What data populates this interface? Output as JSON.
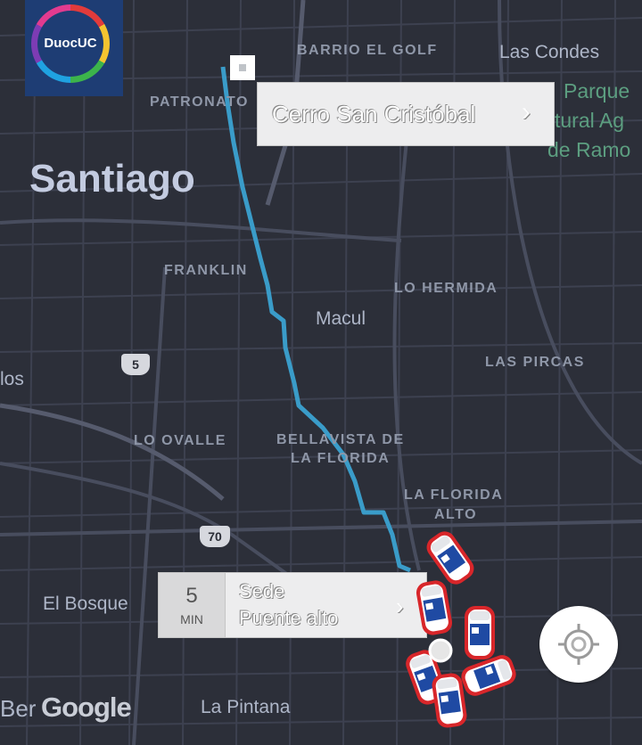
{
  "map": {
    "city": "Santiago",
    "attribution": "Google",
    "labels": {
      "barrio_el_golf": "BARRIO EL GOLF",
      "las_condes": "Las Condes",
      "patronato": "PATRONATO",
      "parque": "Parque",
      "parque_line2": "tural Ag",
      "parque_line3": "de Ramo",
      "franklin": "FRANKLIN",
      "lo_hermida": "LO HERMIDA",
      "macul": "Macul",
      "las_pircas": "LAS PIRCAS",
      "los": "los",
      "lo_ovalle": "LO OVALLE",
      "bellavista": "BELLAVISTA DE",
      "la_florida_line": "LA FLORIDA",
      "la_florida_alto1": "LA FLORIDA",
      "la_florida_alto2": "ALTO",
      "el_bosque": "El Bosque",
      "la_pintana": "La Pintana",
      "ber": "Ber"
    },
    "shields": {
      "route5": "5",
      "route70": "70"
    }
  },
  "logo": {
    "text": "DuocUC"
  },
  "origin_callout": {
    "title": "Cerro San Cristóbal",
    "chevron": "›"
  },
  "destination_callout": {
    "eta_value": "5",
    "eta_unit": "MIN",
    "title_line1": "Sede",
    "title_line2": "Puente alto",
    "chevron": "›"
  },
  "colors": {
    "route": "#3a9cc9",
    "map_bg": "#2c2f39",
    "logo_bg": "#1e3d74"
  }
}
